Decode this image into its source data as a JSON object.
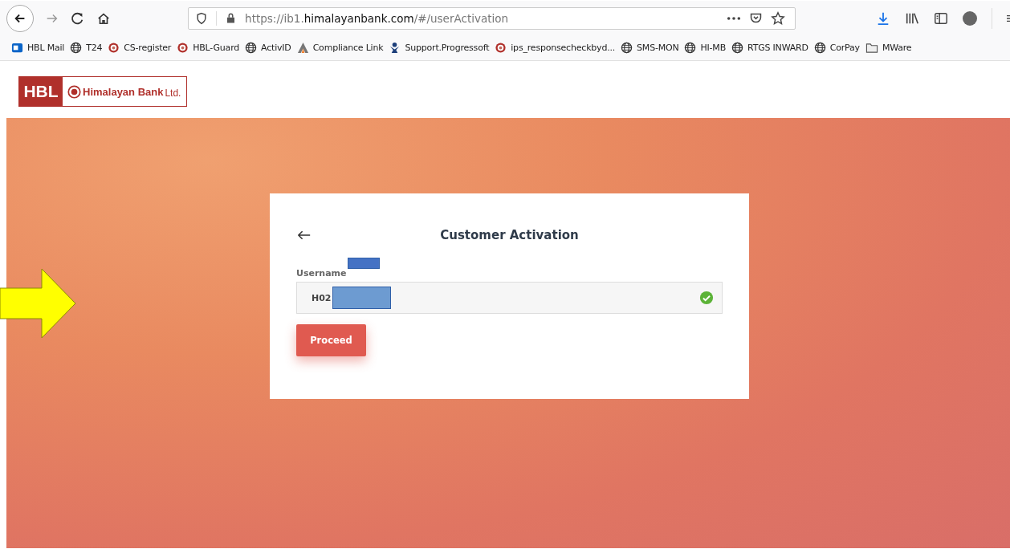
{
  "browser": {
    "url_prefix": "https://ib1.",
    "url_domain": "himalayanbank.com",
    "url_path": "/#/userActivation"
  },
  "bookmarks": [
    {
      "label": "HBL Mail",
      "kind": "mail"
    },
    {
      "label": "T24",
      "kind": "globe"
    },
    {
      "label": "CS-register",
      "kind": "seal"
    },
    {
      "label": "HBL-Guard",
      "kind": "seal"
    },
    {
      "label": "ActivID",
      "kind": "globe"
    },
    {
      "label": "Compliance Link",
      "kind": "peak"
    },
    {
      "label": "Support.Progressoft",
      "kind": "person"
    },
    {
      "label": "ips_responsecheckbyd...",
      "kind": "seal"
    },
    {
      "label": "SMS-MON",
      "kind": "globe"
    },
    {
      "label": "HI-MB",
      "kind": "globe"
    },
    {
      "label": "RTGS INWARD",
      "kind": "globe"
    },
    {
      "label": "CorPay",
      "kind": "globe"
    },
    {
      "label": "MWare",
      "kind": "folder"
    }
  ],
  "logo": {
    "short": "HBL",
    "name": "Himalayan Bank",
    "suffix": "Ltd."
  },
  "card": {
    "title": "Customer Activation",
    "field_label": "Username",
    "field_value": "H02",
    "valid": true,
    "button": "Proceed"
  }
}
